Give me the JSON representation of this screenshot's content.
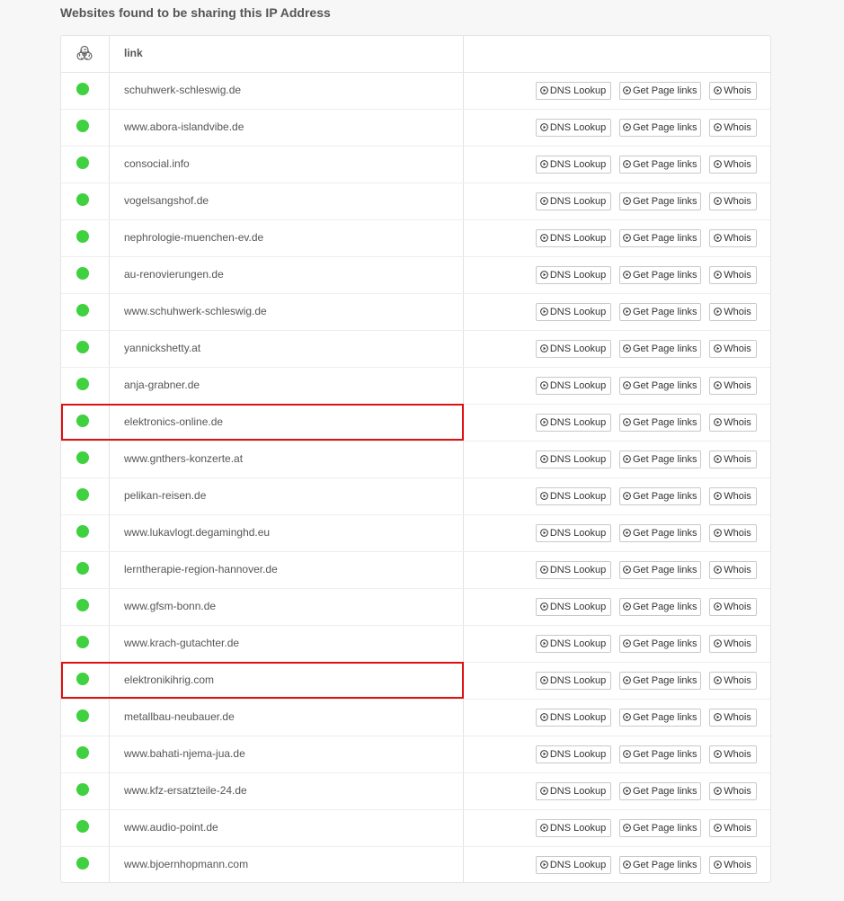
{
  "page": {
    "title": "Websites found to be sharing this IP Address"
  },
  "table": {
    "header": {
      "icon": "biohazard-icon",
      "link_label": "link"
    },
    "buttons": {
      "dns_label": "DNS Lookup",
      "page_links_label": "Get Page links",
      "whois_label": "Whois",
      "icon": "play-circle-icon"
    },
    "status_color": "#3fd13f",
    "highlight_color": "#e01010",
    "rows": [
      {
        "link": "schuhwerk-schleswig.de",
        "highlighted": false
      },
      {
        "link": "www.abora-islandvibe.de",
        "highlighted": false
      },
      {
        "link": "consocial.info",
        "highlighted": false
      },
      {
        "link": "vogelsangshof.de",
        "highlighted": false
      },
      {
        "link": "nephrologie-muenchen-ev.de",
        "highlighted": false
      },
      {
        "link": "au-renovierungen.de",
        "highlighted": false
      },
      {
        "link": "www.schuhwerk-schleswig.de",
        "highlighted": false
      },
      {
        "link": "yannickshetty.at",
        "highlighted": false
      },
      {
        "link": "anja-grabner.de",
        "highlighted": false
      },
      {
        "link": "elektronics-online.de",
        "highlighted": true
      },
      {
        "link": "www.gnthers-konzerte.at",
        "highlighted": false
      },
      {
        "link": "pelikan-reisen.de",
        "highlighted": false
      },
      {
        "link": "www.lukavlogt.degaminghd.eu",
        "highlighted": false
      },
      {
        "link": "lerntherapie-region-hannover.de",
        "highlighted": false
      },
      {
        "link": "www.gfsm-bonn.de",
        "highlighted": false
      },
      {
        "link": "www.krach-gutachter.de",
        "highlighted": false
      },
      {
        "link": "elektronikihrig.com",
        "highlighted": true
      },
      {
        "link": "metallbau-neubauer.de",
        "highlighted": false
      },
      {
        "link": "www.bahati-njema-jua.de",
        "highlighted": false
      },
      {
        "link": "www.kfz-ersatzteile-24.de",
        "highlighted": false
      },
      {
        "link": "www.audio-point.de",
        "highlighted": false
      },
      {
        "link": "www.bjoernhopmann.com",
        "highlighted": false
      }
    ]
  }
}
